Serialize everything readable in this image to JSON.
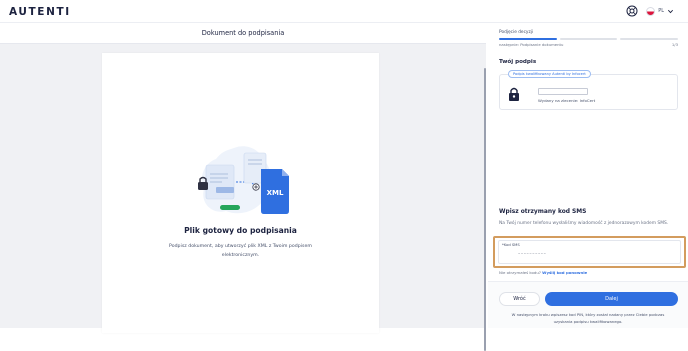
{
  "app": {
    "logo": "AUTENTI",
    "language": "PL",
    "brand_color": "#2f6fe0",
    "highlight_color": "#d39c5e",
    "icons": [
      "help-icon",
      "poland-flag-icon",
      "chevron-down-icon",
      "lock-icon",
      "xml-file-icon",
      "printer-icon"
    ]
  },
  "document_panel": {
    "title": "Dokument do podpisania",
    "file_badge": "XML",
    "ready_title": "Plik gotowy do podpisania",
    "ready_description": "Podpisz dokument, aby utworzyć plik XML z Twoim podpisem elektronicznym."
  },
  "sidebar": {
    "step_label": "Podjęcie decyzji",
    "next_step": "następnie: Podpisanie dokumentu",
    "step_counter": "1/3",
    "progress_fraction": 0.333,
    "signature": {
      "title": "Twój podpis",
      "type_chip": "Podpis kwalifikowany Autenti by Infocert",
      "issuer": "Wydany na zlecenie: InfoCert"
    },
    "sms": {
      "title": "Wpisz otrzymany kod SMS",
      "description": "Na Twój numer telefonu wysłaliśmy wiadomość z jednorazowym kodem SMS.",
      "field_label": "*Kod SMS",
      "placeholder": "––––––––––",
      "resend_question": "Nie otrzymałeś kodu?",
      "resend_link": "Wyślij kod ponownie"
    },
    "footer": {
      "back_label": "Wróć",
      "next_label": "Dalej",
      "note": "W następnym kroku wpiszesz kod PIN, który został nadany przez Ciebie podczas uzyskania podpisu kwalifikowanego."
    }
  }
}
